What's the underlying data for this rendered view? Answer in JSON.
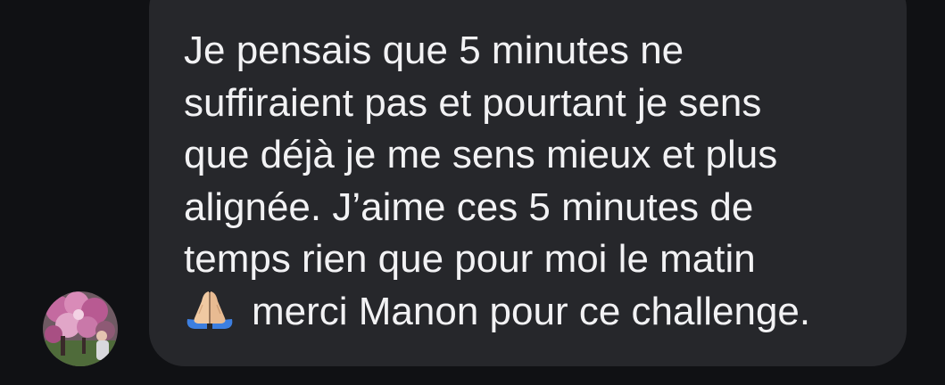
{
  "message": {
    "lines": [
      "Je pensais que 5 minutes ne",
      "suffiraient pas et pourtant je sens",
      "que déjà je me sens mieux et plus",
      "alignée. J’aime ces 5 minutes de",
      "temps rien que pour moi le matin",
      "merci Manon pour ce challenge."
    ],
    "emoji_icon": "folded-hands-icon"
  },
  "colors": {
    "background": "#101114",
    "bubble": "#26272b",
    "text": "#f2f2f4"
  }
}
